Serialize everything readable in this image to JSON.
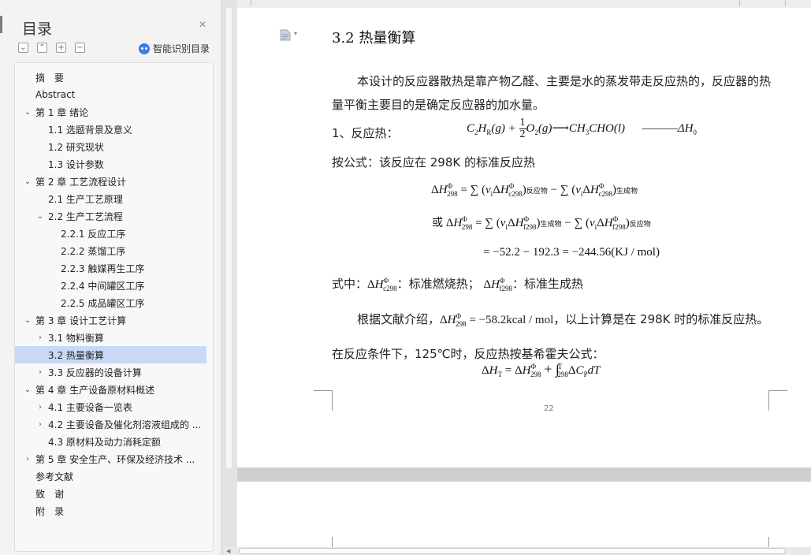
{
  "sidebar": {
    "title": "目录",
    "close_glyph": "×",
    "tool_buttons": [
      "⌄",
      "⌃",
      "+",
      "−"
    ],
    "smart_toc_label": "智能识别目录",
    "toc_items": [
      {
        "level": 0,
        "toggle": "",
        "label": "摘　要",
        "active": false
      },
      {
        "level": 0,
        "toggle": "",
        "label": "Abstract",
        "active": false
      },
      {
        "level": 0,
        "toggle": "⌄",
        "label": "第 1 章  绪论",
        "active": false
      },
      {
        "level": 1,
        "toggle": "",
        "label": "1.1 选题背景及意义",
        "active": false
      },
      {
        "level": 1,
        "toggle": "",
        "label": "1.2 研究现状",
        "active": false
      },
      {
        "level": 1,
        "toggle": "",
        "label": "1.3 设计参数",
        "active": false
      },
      {
        "level": 0,
        "toggle": "⌄",
        "label": "第 2 章  工艺流程设计",
        "active": false
      },
      {
        "level": 1,
        "toggle": "",
        "label": "2.1 生产工艺原理",
        "active": false
      },
      {
        "level": 1,
        "toggle": "⌄",
        "label": "2.2 生产工艺流程",
        "active": false
      },
      {
        "level": 2,
        "toggle": "",
        "label": "2.2.1 反应工序",
        "active": false
      },
      {
        "level": 2,
        "toggle": "",
        "label": "2.2.2 蒸馏工序",
        "active": false
      },
      {
        "level": 2,
        "toggle": "",
        "label": "2.2.3 触媒再生工序",
        "active": false
      },
      {
        "level": 2,
        "toggle": "",
        "label": "2.2.4 中间罐区工序",
        "active": false
      },
      {
        "level": 2,
        "toggle": "",
        "label": "2.2.5 成品罐区工序",
        "active": false
      },
      {
        "level": 0,
        "toggle": "⌄",
        "label": "第 3 章  设计工艺计算",
        "active": false
      },
      {
        "level": 1,
        "toggle": "›",
        "label": "3.1 物料衡算",
        "active": false
      },
      {
        "level": 1,
        "toggle": "",
        "label": "3.2 热量衡算",
        "active": true
      },
      {
        "level": 1,
        "toggle": "›",
        "label": "3.3 反应器的设备计算",
        "active": false
      },
      {
        "level": 0,
        "toggle": "⌄",
        "label": "第 4 章  生产设备原材料概述",
        "active": false
      },
      {
        "level": 1,
        "toggle": "›",
        "label": "4.1 主要设备一览表",
        "active": false
      },
      {
        "level": 1,
        "toggle": "›",
        "label": "4.2 主要设备及催化剂溶液组成的 ...",
        "active": false
      },
      {
        "level": 1,
        "toggle": "",
        "label": "4.3 原材料及动力消耗定额",
        "active": false
      },
      {
        "level": 0,
        "toggle": "›",
        "label": "第 5 章  安全生产、环保及经济技术 ...",
        "active": false
      },
      {
        "level": 0,
        "toggle": "",
        "label": "参考文献",
        "active": false
      },
      {
        "level": 0,
        "toggle": "",
        "label": "致　谢",
        "active": false
      },
      {
        "level": 0,
        "toggle": "",
        "label": "附　录",
        "active": false
      }
    ]
  },
  "document": {
    "heading": "3.2 热量衡算",
    "para1": "本设计的反应器散热是靠产物乙醛、主要是水的蒸发带走反应热的，反应器的热量平衡主要目的是确定反应器的加水量。",
    "reaction_label": "1、反应热：",
    "formula_intro": "按公式：该反应在 298K 的标准反应热",
    "eq_result": "= −52.2 − 192.3 = −244.56(KJ / mol)",
    "legend_prefix": "式中：",
    "legend_c": "：标准燃烧热；",
    "legend_f": "：标准生成热",
    "para2_a": "根据文献介绍，",
    "para2_val": "= −58.2kcal / mol",
    "para2_b": "，以上计算是在 298K 时的标准反应热。在反应条件下，125℃时，反应热按基希霍夫公式：",
    "or_label": "或",
    "sub_reactant": "反应物",
    "sub_product": "生成物",
    "page_number": "22"
  }
}
